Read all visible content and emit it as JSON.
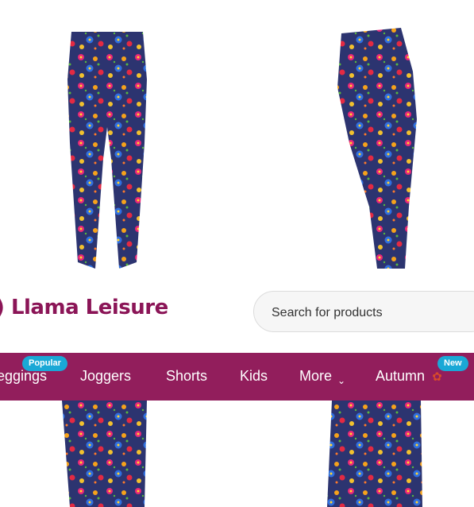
{
  "brand": {
    "name": "Llama Leisure"
  },
  "search": {
    "placeholder": "Search for products"
  },
  "nav": {
    "items": [
      {
        "label": "eggings",
        "badge": "Popular"
      },
      {
        "label": "Joggers"
      },
      {
        "label": "Shorts"
      },
      {
        "label": "Kids"
      },
      {
        "label": "More"
      },
      {
        "label": "Autumn",
        "badge": "New"
      }
    ]
  },
  "colors": {
    "brand": "#8b1557",
    "nav_bg": "#921e5c",
    "badge": "#1aa8d6",
    "legging_base": "#2c3470"
  }
}
